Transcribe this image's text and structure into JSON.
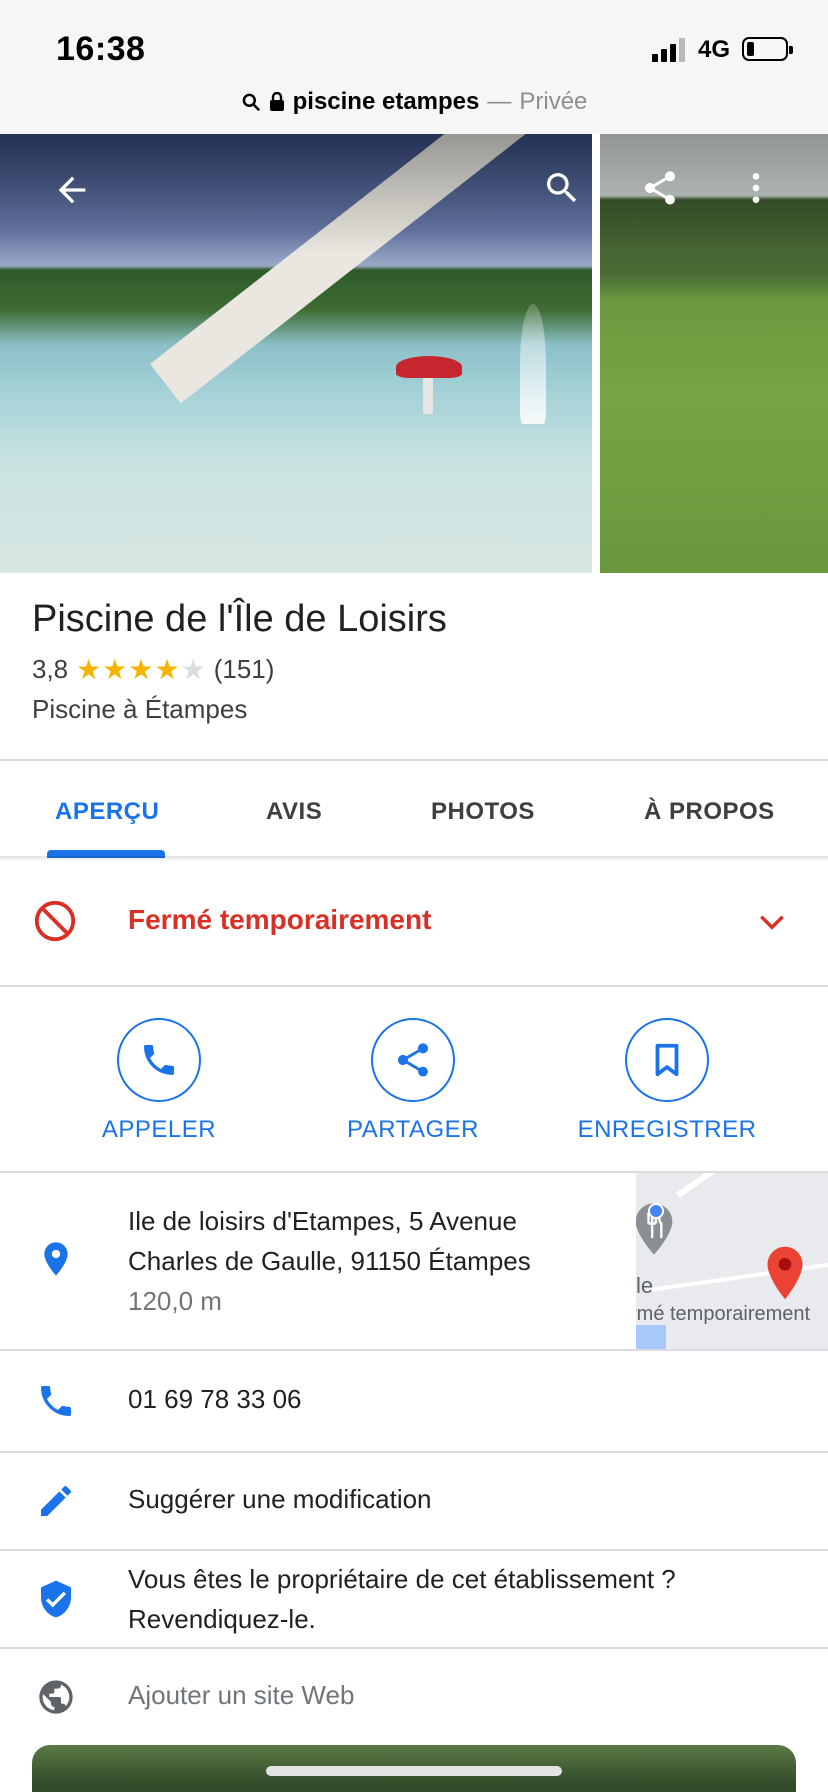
{
  "status_bar": {
    "time": "16:38",
    "network": "4G",
    "battery_percent": 20
  },
  "url_bar": {
    "query": "piscine etampes",
    "separator": "—",
    "mode": "Privée"
  },
  "place": {
    "name": "Piscine de l'Île de Loisirs",
    "rating": "3,8",
    "rating_value": 3.8,
    "review_count": "(151)",
    "category": "Piscine à Étampes"
  },
  "tabs": [
    {
      "label": "APERÇU",
      "active": true
    },
    {
      "label": "AVIS",
      "active": false
    },
    {
      "label": "PHOTOS",
      "active": false
    },
    {
      "label": "À PROPOS",
      "active": false
    }
  ],
  "closed_status": {
    "label": "Fermé temporairement"
  },
  "actions": [
    {
      "label": "APPELER",
      "icon": "phone-icon"
    },
    {
      "label": "PARTAGER",
      "icon": "share-icon"
    },
    {
      "label": "ENREGISTRER",
      "icon": "bookmark-icon"
    }
  ],
  "address": {
    "line1": "Ile de loisirs d'Etampes, 5 Avenue",
    "line2": "Charles de Gaulle, 91150 Étampes",
    "distance": "120,0 m"
  },
  "map_thumb": {
    "label_short": "le",
    "label_status": "rmé temporairement"
  },
  "phone": {
    "number": "01 69 78 33 06"
  },
  "suggest": {
    "label": "Suggérer une modification"
  },
  "claim": {
    "line1": "Vous êtes le propriétaire de cet établissement ?",
    "line2": "Revendiquez-le."
  },
  "website": {
    "label": "Ajouter un site Web"
  },
  "colors": {
    "accent": "#1a73e8",
    "closed": "#d93025",
    "star": "#f4b400"
  }
}
